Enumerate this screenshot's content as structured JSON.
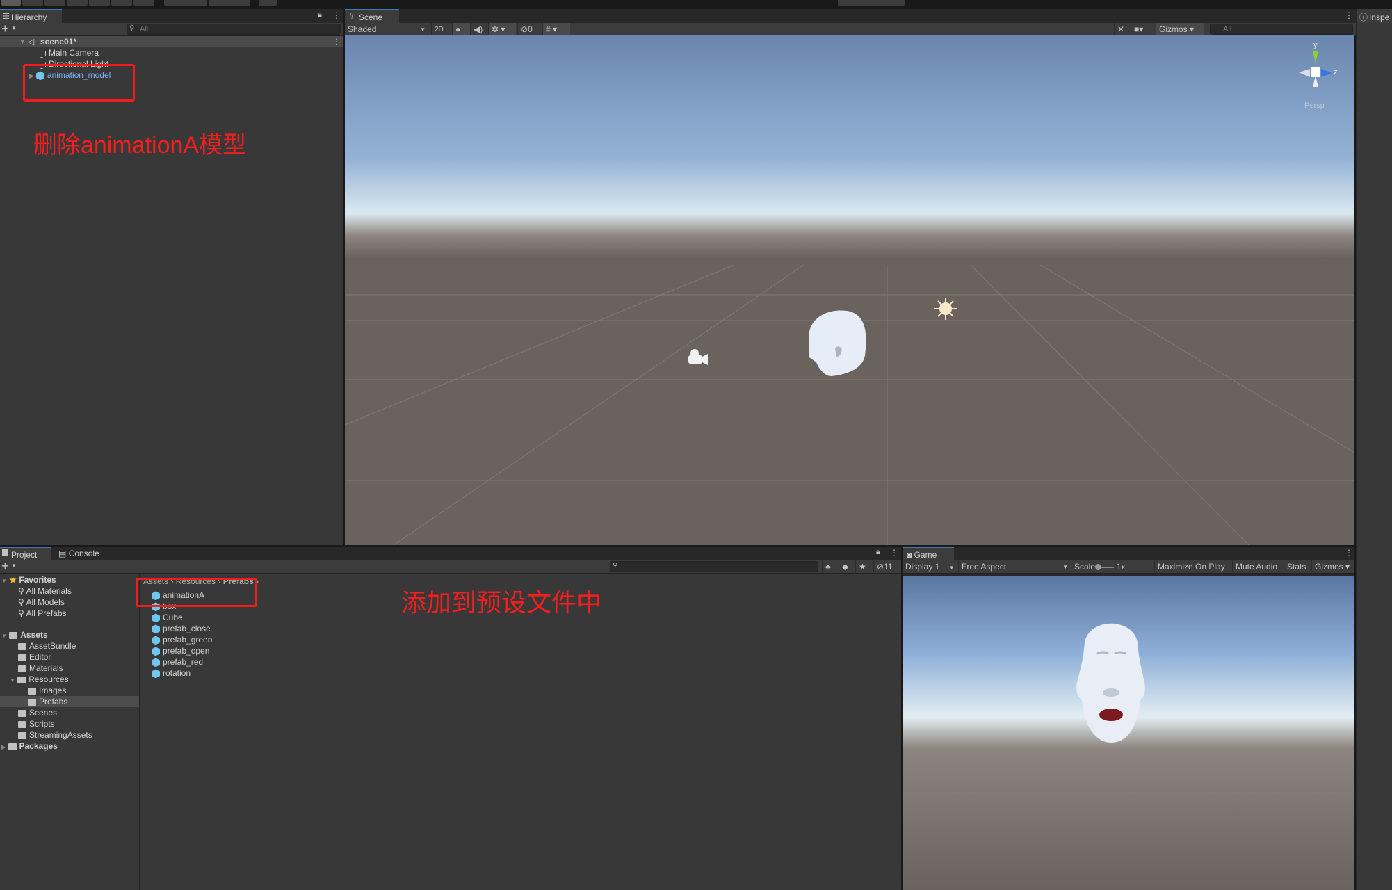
{
  "hierarchy": {
    "tab": "Hierarchy",
    "search_placeholder": "All",
    "scene": "scene01*",
    "items": [
      "Main Camera",
      "Directional Light",
      "animation_model"
    ]
  },
  "scene": {
    "tab": "Scene",
    "shading": "Shaded",
    "mode_2d": "2D",
    "hidden_count": "0",
    "gizmos": "Gizmos",
    "search_placeholder": "All",
    "persp": "Persp",
    "axis_y": "y",
    "axis_z": "z"
  },
  "inspector": {
    "tab": "Inspe"
  },
  "project": {
    "tabs": [
      "Project",
      "Console"
    ],
    "hidden_count": "11",
    "favorites": {
      "label": "Favorites",
      "items": [
        "All Materials",
        "All Models",
        "All Prefabs"
      ]
    },
    "assets": {
      "label": "Assets",
      "items": [
        "AssetBundle",
        "Editor",
        "Materials",
        "Resources",
        "Images",
        "Prefabs",
        "Scenes",
        "Scripts",
        "StreamingAssets"
      ]
    },
    "packages": "Packages",
    "breadcrumb": [
      "Assets",
      "Resources",
      "Prefabs"
    ],
    "files": [
      "animationA",
      "box",
      "Cube",
      "prefab_close",
      "prefab_green",
      "prefab_open",
      "prefab_red",
      "rotation"
    ]
  },
  "game": {
    "tab": "Game",
    "display": "Display 1",
    "aspect": "Free Aspect",
    "scale_label": "Scale",
    "scale_value": "1x",
    "maximize": "Maximize On Play",
    "mute": "Mute Audio",
    "stats": "Stats",
    "gizmos": "Gizmos"
  },
  "annotations": {
    "delete_note": "删除animationA模型",
    "add_note": "添加到预设文件中"
  },
  "colors": {
    "annotation": "#f21c1c",
    "selected_blue": "#7cb3f5",
    "prefab_icon": "#6fc6f0"
  }
}
